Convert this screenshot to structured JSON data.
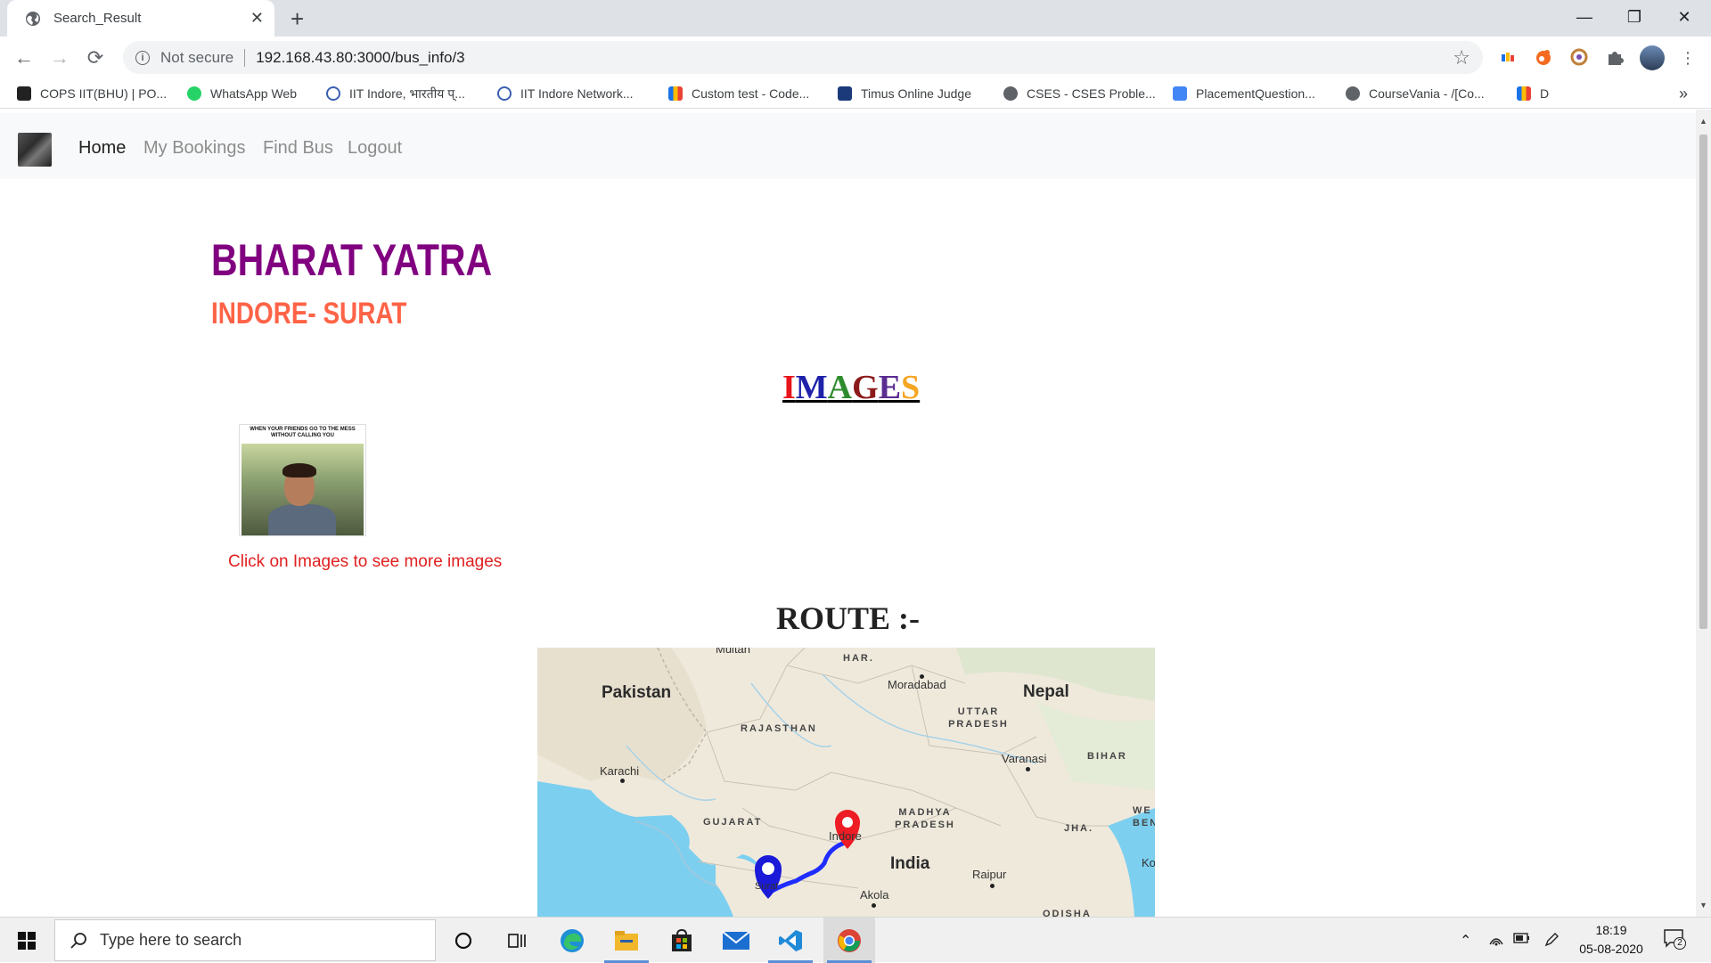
{
  "browser": {
    "tab_title": "Search_Result",
    "not_secure": "Not secure",
    "url": "192.168.43.80:3000/bus_info/3",
    "bookmarks": [
      "COPS IIT(BHU) | PO...",
      "WhatsApp Web",
      "IIT Indore, भारतीय प्...",
      "IIT Indore Network...",
      "Custom test - Code...",
      "Timus Online Judge",
      "CSES - CSES Proble...",
      "PlacementQuestion...",
      "CourseVania - /[Co...",
      "D"
    ],
    "more_bookmarks": "»"
  },
  "site_nav": {
    "links": [
      "Home",
      "My Bookings",
      "Find Bus",
      "Logout"
    ]
  },
  "page": {
    "title": "BHARAT YATRA",
    "route_name": "INDORE- SURAT",
    "images_heading_letters": [
      "I",
      "M",
      "A",
      "G",
      "E",
      "S"
    ],
    "images_heading_colors": [
      "#e8141b",
      "#1e22aa",
      "#2e8b2e",
      "#8b1a1a",
      "#5b2d90",
      "#f5a623"
    ],
    "thumbnail_caption": "WHEN YOUR FRIENDS GO TO THE MESS WITHOUT CALLING YOU",
    "thumbnail_note": "Click on Images to see more images",
    "route_heading": "ROUTE :-"
  },
  "map": {
    "countries": [
      "Pakistan",
      "Nepal",
      "India"
    ],
    "states": [
      "HAR.",
      "UTTAR PRADESH",
      "RAJASTHAN",
      "BIHAR",
      "GUJARAT",
      "MADHYA PRADESH",
      "JHA.",
      "WE BEN",
      "ODISHA"
    ],
    "cities": [
      "Multan",
      "Moradabad",
      "Varanasi",
      "Karachi",
      "Indore",
      "Surat",
      "Raipur",
      "Akola",
      "Ko"
    ],
    "origin_marker": "red-location-pin",
    "destination_marker": "blue-location-pin"
  },
  "taskbar": {
    "search_placeholder": "Type here to search",
    "time": "18:19",
    "date": "05-08-2020",
    "notification_count": "2"
  }
}
